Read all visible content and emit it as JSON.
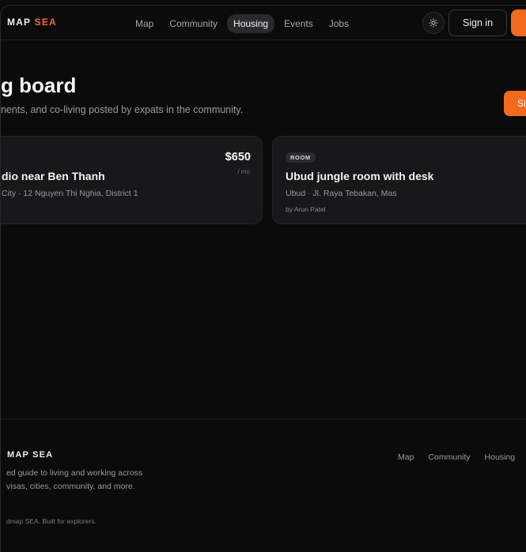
{
  "header": {
    "logo_main": "MAP",
    "logo_accent": "SEA",
    "nav": [
      "Map",
      "Community",
      "Housing",
      "Events",
      "Jobs"
    ],
    "active_nav": "Housing",
    "signin_label": "Sign in"
  },
  "page": {
    "title": "g board",
    "subtitle": "nents, and co-living posted by expats in the community.",
    "signup_label": "Si"
  },
  "listings": [
    {
      "price": "$650",
      "per": "/ mo",
      "title": "dio near Ben Thanh",
      "location": "City · 12 Nguyen Thi Nghia, District 1"
    },
    {
      "badge": "ROOM",
      "title": "Ubud jungle room with desk",
      "location": "Ubud · Jl. Raya Tebakan, Mas",
      "by": "by Arun Patel"
    }
  ],
  "footer": {
    "logo": "MAP SEA",
    "desc_line1": "ed guide to living and working across",
    "desc_line2": "visas, cities, community, and more.",
    "copyright": "dmap SEA. Built for explorers.",
    "nav": [
      "Map",
      "Community",
      "Housing"
    ]
  },
  "colors": {
    "accent": "#f26a1b",
    "background": "#0b0b0c",
    "card": "#18181a"
  },
  "icons": {
    "theme_toggle": "sun-icon"
  }
}
